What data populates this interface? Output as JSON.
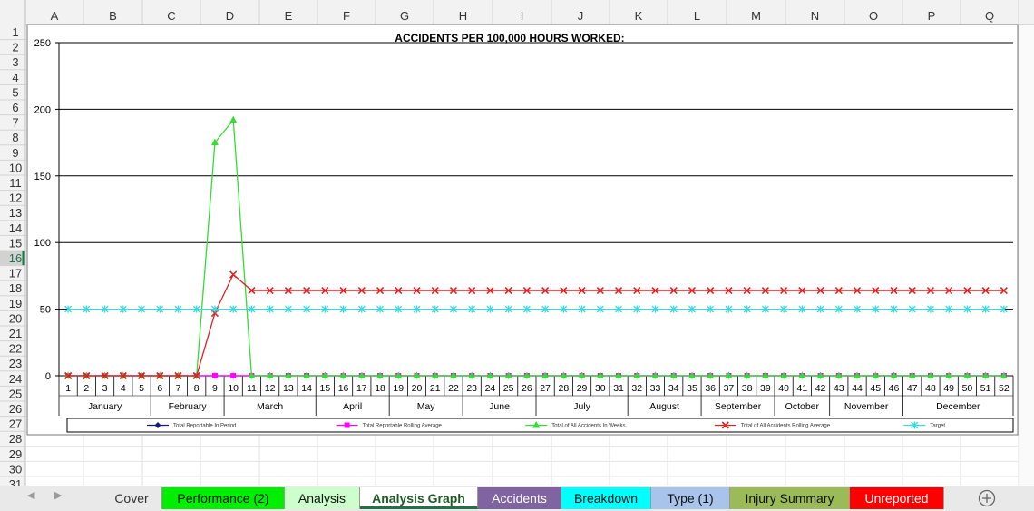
{
  "columns": [
    "A",
    "B",
    "C",
    "D",
    "E",
    "F",
    "G",
    "H",
    "I",
    "J",
    "K",
    "L",
    "M",
    "N",
    "O",
    "P",
    "Q"
  ],
  "rows": [
    "1",
    "2",
    "3",
    "4",
    "5",
    "6",
    "7",
    "8",
    "9",
    "10",
    "11",
    "12",
    "13",
    "14",
    "15",
    "16",
    "17",
    "18",
    "19",
    "20",
    "21",
    "22",
    "23",
    "24",
    "25",
    "26",
    "27",
    "28",
    "29",
    "30",
    "31"
  ],
  "selected_row": "16",
  "chart_data": {
    "type": "line",
    "title": "ACCIDENTS PER 100,000 HOURS WORKED:",
    "ylim": [
      0,
      250
    ],
    "yticks": [
      0,
      50,
      100,
      150,
      200,
      250
    ],
    "grid": true,
    "x": [
      1,
      2,
      3,
      4,
      5,
      6,
      7,
      8,
      9,
      10,
      11,
      12,
      13,
      14,
      15,
      16,
      17,
      18,
      19,
      20,
      21,
      22,
      23,
      24,
      25,
      26,
      27,
      28,
      29,
      30,
      31,
      32,
      33,
      34,
      35,
      36,
      37,
      38,
      39,
      40,
      41,
      42,
      43,
      44,
      45,
      46,
      47,
      48,
      49,
      50,
      51,
      52
    ],
    "months": [
      {
        "name": "January",
        "start": 1,
        "end": 5
      },
      {
        "name": "February",
        "start": 6,
        "end": 9
      },
      {
        "name": "March",
        "start": 10,
        "end": 14
      },
      {
        "name": "April",
        "start": 15,
        "end": 18
      },
      {
        "name": "May",
        "start": 19,
        "end": 22
      },
      {
        "name": "June",
        "start": 23,
        "end": 26
      },
      {
        "name": "July",
        "start": 27,
        "end": 31
      },
      {
        "name": "August",
        "start": 32,
        "end": 35
      },
      {
        "name": "September",
        "start": 36,
        "end": 39
      },
      {
        "name": "October",
        "start": 40,
        "end": 42
      },
      {
        "name": "November",
        "start": 43,
        "end": 46
      },
      {
        "name": "December",
        "start": 47,
        "end": 52
      }
    ],
    "legend_position": "bottom",
    "series": [
      {
        "name": "Total Reportable In Period",
        "color": "#1a1a7a",
        "marker": "diamond",
        "values": [
          0,
          0,
          0,
          0,
          0,
          0,
          0,
          0,
          0,
          0,
          0,
          0,
          0,
          0,
          0,
          0,
          0,
          0,
          0,
          0,
          0,
          0,
          0,
          0,
          0,
          0,
          0,
          0,
          0,
          0,
          0,
          0,
          0,
          0,
          0,
          0,
          0,
          0,
          0,
          0,
          0,
          0,
          0,
          0,
          0,
          0,
          0,
          0,
          0,
          0,
          0,
          0
        ]
      },
      {
        "name": "Total Reportable Rolling Average",
        "color": "#ff00ff",
        "marker": "square",
        "values": [
          0,
          0,
          0,
          0,
          0,
          0,
          0,
          0,
          0,
          0,
          0,
          0,
          0,
          0,
          0,
          0,
          0,
          0,
          0,
          0,
          0,
          0,
          0,
          0,
          0,
          0,
          0,
          0,
          0,
          0,
          0,
          0,
          0,
          0,
          0,
          0,
          0,
          0,
          0,
          0,
          0,
          0,
          0,
          0,
          0,
          0,
          0,
          0,
          0,
          0,
          0,
          0
        ]
      },
      {
        "name": "Total of All Accidents In Weeks",
        "color": "#33dd33",
        "marker": "triangle",
        "values": [
          0,
          0,
          0,
          0,
          0,
          0,
          0,
          0,
          175,
          192,
          0,
          0,
          0,
          0,
          0,
          0,
          0,
          0,
          0,
          0,
          0,
          0,
          0,
          0,
          0,
          0,
          0,
          0,
          0,
          0,
          0,
          0,
          0,
          0,
          0,
          0,
          0,
          0,
          0,
          0,
          0,
          0,
          0,
          0,
          0,
          0,
          0,
          0,
          0,
          0,
          0,
          0
        ]
      },
      {
        "name": "Total of All Accidents Rolling Average",
        "color": "#dd2222",
        "marker": "x",
        "values": [
          0,
          0,
          0,
          0,
          0,
          0,
          0,
          0,
          47,
          76,
          64,
          64,
          64,
          64,
          64,
          64,
          64,
          64,
          64,
          64,
          64,
          64,
          64,
          64,
          64,
          64,
          64,
          64,
          64,
          64,
          64,
          64,
          64,
          64,
          64,
          64,
          64,
          64,
          64,
          64,
          64,
          64,
          64,
          64,
          64,
          64,
          64,
          64,
          64,
          64,
          64,
          64
        ]
      },
      {
        "name": "Target",
        "color": "#33dddd",
        "marker": "star",
        "values": [
          50,
          50,
          50,
          50,
          50,
          50,
          50,
          50,
          50,
          50,
          50,
          50,
          50,
          50,
          50,
          50,
          50,
          50,
          50,
          50,
          50,
          50,
          50,
          50,
          50,
          50,
          50,
          50,
          50,
          50,
          50,
          50,
          50,
          50,
          50,
          50,
          50,
          50,
          50,
          50,
          50,
          50,
          50,
          50,
          50,
          50,
          50,
          50,
          50,
          50,
          50,
          50
        ]
      }
    ]
  },
  "sheet_tabs": [
    {
      "label": "Cover",
      "color": "#e9e9e9",
      "text": "#333333"
    },
    {
      "label": "Performance (2)",
      "color": "#00ee00",
      "text": "#111111"
    },
    {
      "label": "Analysis",
      "color": "#ccffcc",
      "text": "#111111"
    },
    {
      "label": "Analysis Graph",
      "color": "#ffffff",
      "text": "#1e5a25",
      "active": true
    },
    {
      "label": "Accidents",
      "color": "#8064a2",
      "text": "#ffffff"
    },
    {
      "label": "Breakdown",
      "color": "#00ffff",
      "text": "#111111"
    },
    {
      "label": "Type (1)",
      "color": "#a9c4eb",
      "text": "#111111"
    },
    {
      "label": "Injury Summary",
      "color": "#9bbb59",
      "text": "#111111"
    },
    {
      "label": "Unreported",
      "color": "#ff0000",
      "text": "#ffffff"
    }
  ]
}
